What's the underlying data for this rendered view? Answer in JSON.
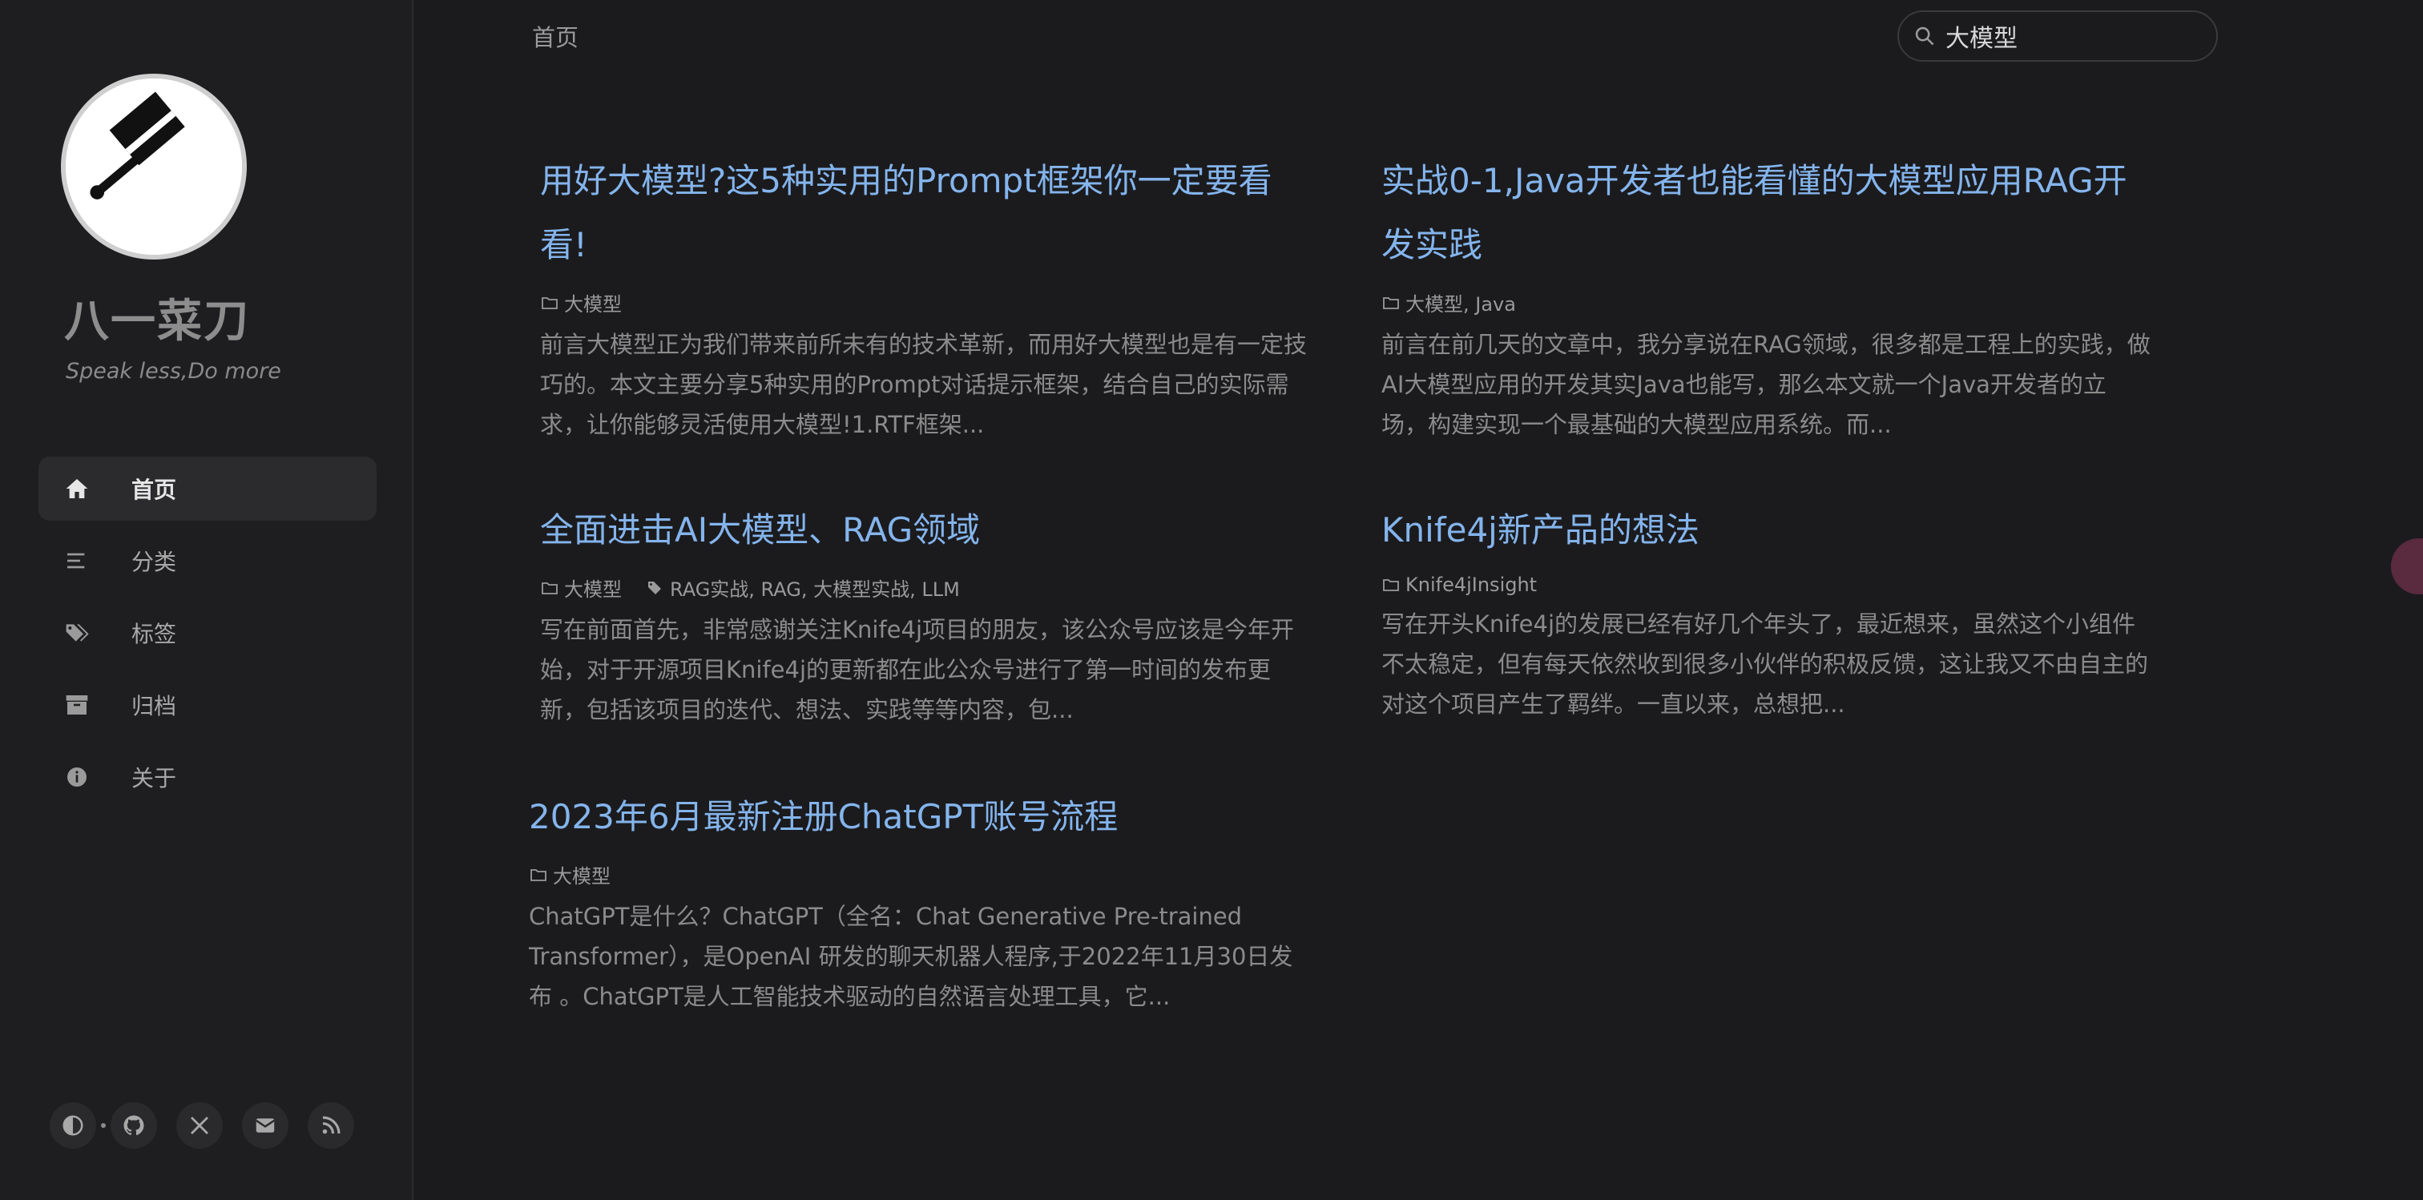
{
  "site": {
    "title": "八一菜刀",
    "subtitle": "Speak less,Do more"
  },
  "nav": [
    {
      "label": "首页",
      "icon": "home-icon",
      "active": true
    },
    {
      "label": "分类",
      "icon": "list-icon"
    },
    {
      "label": "标签",
      "icon": "tags-icon"
    },
    {
      "label": "归档",
      "icon": "archive-icon"
    },
    {
      "label": "关于",
      "icon": "info-icon"
    }
  ],
  "footer": [
    "theme-toggle-icon",
    "github-icon",
    "x-twitter-icon",
    "email-icon",
    "rss-icon"
  ],
  "topbar": {
    "breadcrumb": "首页",
    "search_value": "大模型"
  },
  "posts": [
    {
      "title": "用好大模型?这5种实用的Prompt框架你一定要看看!",
      "categories": "大模型",
      "tags": "",
      "excerpt": "前言大模型正为我们带来前所未有的技术革新，而用好大模型也是有一定技巧的。本文主要分享5种实用的Prompt对话提示框架，结合自己的实际需求，让你能够灵活使用大模型!1.RTF框架..."
    },
    {
      "title": "实战0-1,Java开发者也能看懂的大模型应用RAG开发实践",
      "categories": "大模型, Java",
      "tags": "",
      "excerpt": "前言在前几天的文章中，我分享说在RAG领域，很多都是工程上的实践，做AI大模型应用的开发其实Java也能写，那么本文就一个Java开发者的立场，构建实现一个最基础的大模型应用系统。而..."
    },
    {
      "title": "全面进击AI大模型、RAG领域",
      "categories": "大模型",
      "tags": "RAG实战, RAG, 大模型实战, LLM",
      "excerpt": "写在前面首先，非常感谢关注Knife4j项目的朋友，该公众号应该是今年开始，对于开源项目Knife4j的更新都在此公众号进行了第一时间的发布更新，包括该项目的迭代、想法、实践等等内容，包..."
    },
    {
      "title": "Knife4j新产品的想法",
      "categories": "Knife4jInsight",
      "tags": "",
      "excerpt": "写在开头Knife4j的发展已经有好几个年头了，最近想来，虽然这个小组件不太稳定，但有每天依然收到很多小伙伴的积极反馈，这让我又不由自主的对这个项目产生了羁绊。一直以来，总想把..."
    },
    {
      "title": "2023年6月最新注册ChatGPT账号流程",
      "categories": "大模型",
      "tags": "",
      "excerpt": "ChatGPT是什么？ChatGPT（全名：Chat Generative Pre-trained Transformer），是OpenAI 研发的聊天机器人程序,于2022年11月30日发布 。ChatGPT是人工智能技术驱动的自然语言处理工具，它..."
    }
  ],
  "colors": {
    "background": "#1b1b1e",
    "link": "#84b4ec",
    "text_muted": "#8b8b8b"
  }
}
